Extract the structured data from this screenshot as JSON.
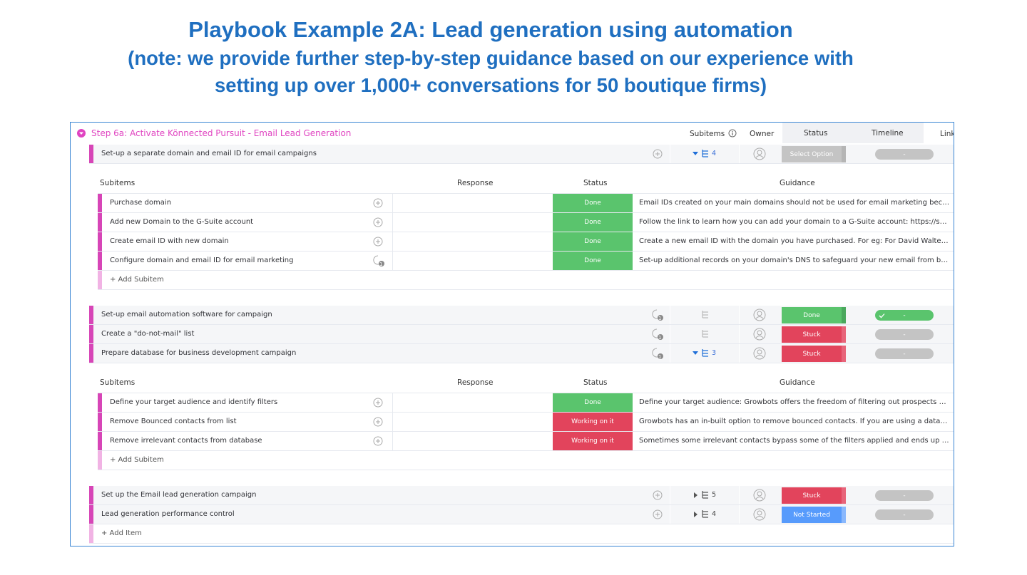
{
  "slide": {
    "title_line1": "Playbook Example 2A: Lead generation using automation",
    "title_line2": "(note: we provide further step-by-step guidance based on our experience with",
    "title_line3": "setting up over 1,000+ conversations for 50 boutique firms)"
  },
  "group": {
    "title": "Step 6a: Activate Könnected Pursuit - Email Lead Generation",
    "columns": {
      "subitems": "Subitems",
      "owner": "Owner",
      "status": "Status",
      "timeline": "Timeline",
      "link": "Link"
    }
  },
  "subtable_columns": {
    "subitems": "Subitems",
    "response": "Response",
    "status": "Status",
    "guidance": "Guidance"
  },
  "colors": {
    "done": "#5ac46d",
    "stuck": "#e2445c",
    "working": "#e2445c",
    "not_started": "#579bfc",
    "select": "#c4c4c4",
    "group": "#e044c1",
    "title": "#1f6fc0"
  },
  "items": [
    {
      "name": "Set-up a separate domain and email ID for email campaigns",
      "subitem_count": "4",
      "status": "Select Option",
      "status_key": "select",
      "timeline": "-"
    },
    {
      "name": "Set-up email automation software for campaign",
      "subitem_count": "",
      "status": "Done",
      "status_key": "done",
      "timeline": "-"
    },
    {
      "name": "Create a \"do-not-mail\" list",
      "subitem_count": "",
      "status": "Stuck",
      "status_key": "stuck",
      "timeline": "-"
    },
    {
      "name": "Prepare database for business development campaign",
      "subitem_count": "3",
      "status": "Stuck",
      "status_key": "stuck",
      "timeline": "-"
    },
    {
      "name": "Set up the Email lead generation campaign",
      "subitem_count": "5",
      "status": "Stuck",
      "status_key": "stuck",
      "timeline": "-"
    },
    {
      "name": "Lead generation performance control",
      "subitem_count": "4",
      "status": "Not Started",
      "status_key": "not_started",
      "timeline": "-"
    }
  ],
  "subitems_a": [
    {
      "name": "Purchase domain",
      "status": "Done",
      "guidance": "Email IDs created on your main domains should not be used for email marketing because you shou..."
    },
    {
      "name": "Add new Domain to the G-Suite account",
      "status": "Done",
      "guidance": "Follow the link to learn how you can add your domain to a G-Suite account: https://support.google..."
    },
    {
      "name": "Create email ID with new domain",
      "status": "Done",
      "guidance": "Create a new email ID with the domain you have purchased. For eg: For David Walter david.walter@..."
    },
    {
      "name": "Configure domain and email ID for email marketing",
      "status": "Done",
      "guidance": "Set-up additional records on your domain's DNS to safeguard your new email from being classified ...",
      "update_count": "1"
    }
  ],
  "subitems_b": [
    {
      "name": "Define your target audience and identify filters",
      "status": "Done",
      "guidance": "Define your target audience: Growbots offers the freedom of filtering out prospects based on your ..."
    },
    {
      "name": "Remove Bounced contacts from list",
      "status": "Working on it",
      "guidance": "Growbots has an in-built option to remove bounced contacts. If you are using a database from anot..."
    },
    {
      "name": "Remove irrelevant contacts from database",
      "status": "Working on it",
      "guidance": "Sometimes some irrelevant contacts bypass some of the filters applied and ends up in your campa..."
    }
  ],
  "labels": {
    "add_subitem": "+ Add Subitem",
    "add_item": "+ Add Item",
    "update_count": "1"
  }
}
